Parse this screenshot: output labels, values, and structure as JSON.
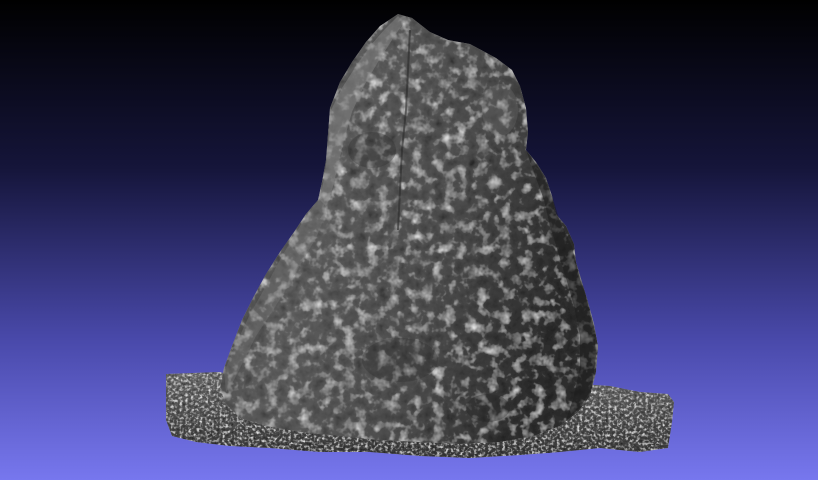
{
  "viewer": {
    "background_top_color": "#000000",
    "background_bottom_color": "#7777ee",
    "mesh_color": "#5a5a5a",
    "mesh_highlight_color": "#9a9a9a",
    "mesh_shadow_color": "#262626",
    "subject": "scanned-standing-stone-mesh"
  }
}
